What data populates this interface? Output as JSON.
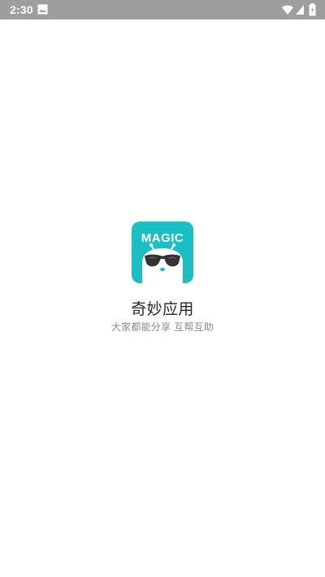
{
  "status_bar": {
    "time": "2:30",
    "icons": [
      "gallery-icon",
      "wifi-icon",
      "signal-icon",
      "battery-icon"
    ]
  },
  "splash": {
    "logo_text": "MAGIC",
    "app_name": "奇妙应用",
    "slogan": "大家都能分享 互帮互助",
    "colors": {
      "brand": "#18c0c5",
      "status_bar": "#9e9e9e",
      "background": "#ffffff",
      "title": "#262626",
      "subtitle": "#8a8a8a"
    }
  }
}
